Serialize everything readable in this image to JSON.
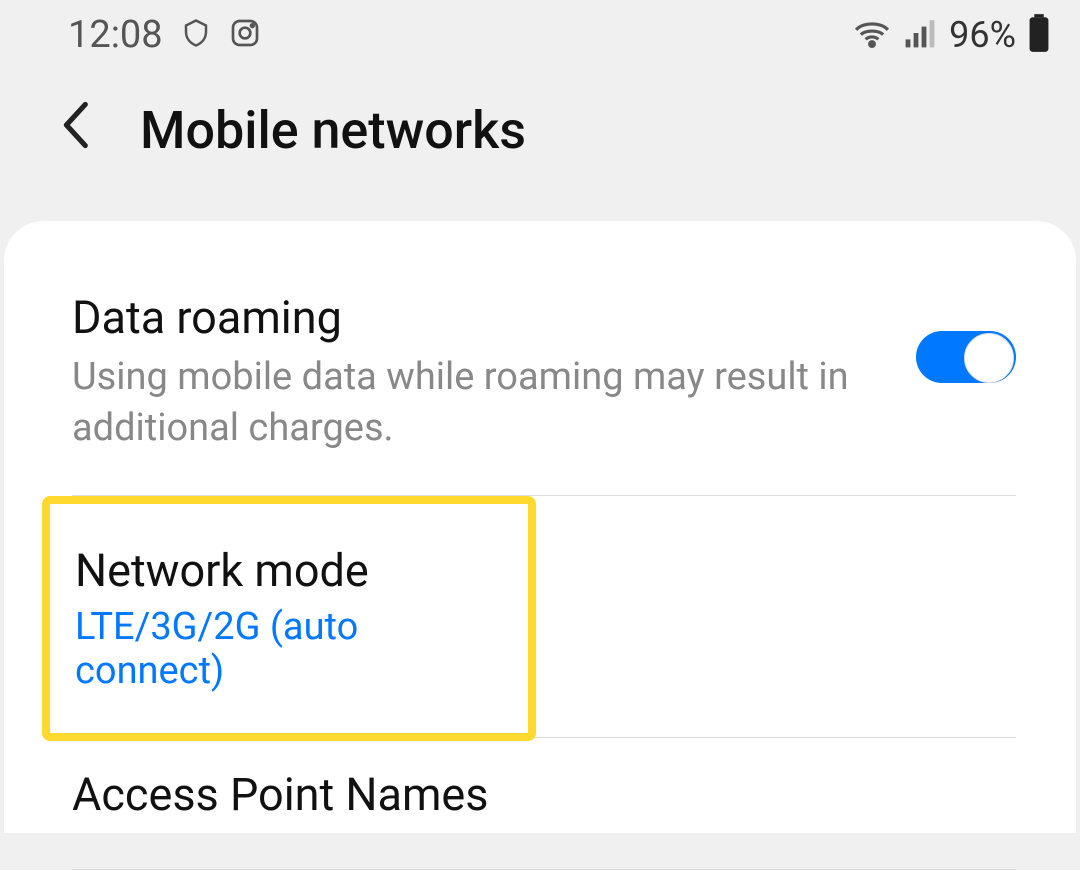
{
  "status_bar": {
    "time": "12:08",
    "battery_percent": "96%"
  },
  "header": {
    "title": "Mobile networks"
  },
  "settings": {
    "data_roaming": {
      "title": "Data roaming",
      "subtitle": "Using mobile data while roaming may result in additional charges.",
      "enabled": true
    },
    "network_mode": {
      "title": "Network mode",
      "value": "LTE/3G/2G (auto connect)"
    },
    "apn": {
      "title": "Access Point Names"
    }
  }
}
